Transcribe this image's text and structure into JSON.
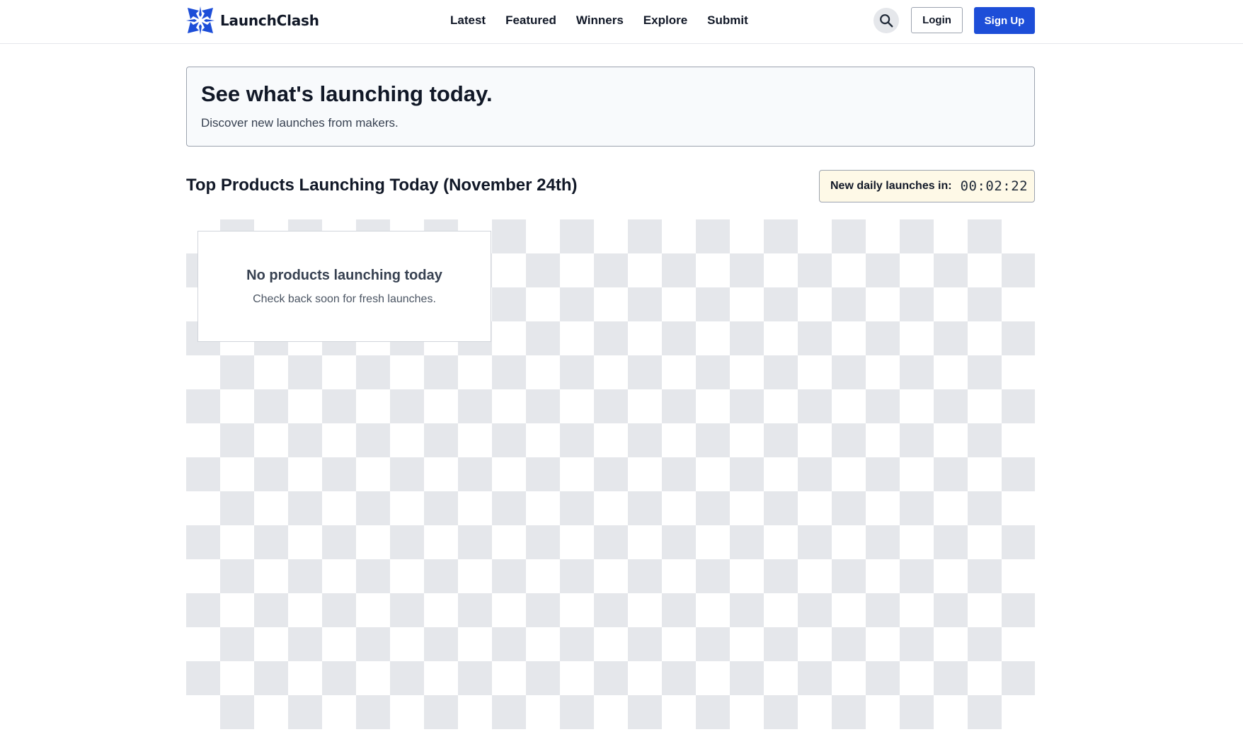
{
  "brand": {
    "name": "LaunchClash",
    "logo_icon": "snowflake-star-icon",
    "accent_color": "#1d4ed8"
  },
  "nav": {
    "items": [
      "Latest",
      "Featured",
      "Winners",
      "Explore",
      "Submit"
    ]
  },
  "header": {
    "search_icon": "search-icon",
    "login_label": "Login",
    "signup_label": "Sign Up"
  },
  "hero": {
    "title": "See what's launching today.",
    "subtitle": "Discover new launches from makers."
  },
  "section": {
    "title": "Top Products Launching Today (November 24th)"
  },
  "countdown": {
    "label": "New daily launches in:",
    "time": "00:02:22"
  },
  "empty_state": {
    "title": "No products launching today",
    "subtitle": "Check back soon for fresh launches."
  }
}
